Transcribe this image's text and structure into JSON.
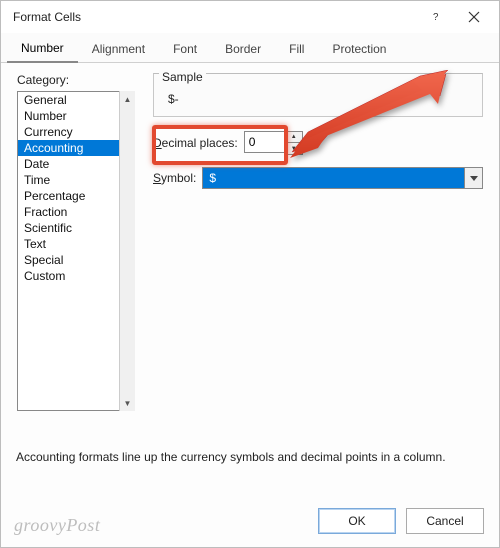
{
  "titlebar": {
    "title": "Format Cells"
  },
  "tabs": {
    "items": [
      "Number",
      "Alignment",
      "Font",
      "Border",
      "Fill",
      "Protection"
    ],
    "active_index": 0
  },
  "category": {
    "label": "Category:",
    "items": [
      "General",
      "Number",
      "Currency",
      "Accounting",
      "Date",
      "Time",
      "Percentage",
      "Fraction",
      "Scientific",
      "Text",
      "Special",
      "Custom"
    ],
    "selected_index": 3
  },
  "sample": {
    "label": "Sample",
    "value": "$-"
  },
  "decimal": {
    "label": "Decimal places:",
    "value": "0"
  },
  "symbol": {
    "label": "Symbol:",
    "value": "$"
  },
  "description": "Accounting formats line up the currency symbols and decimal points in a column.",
  "footer": {
    "ok": "OK",
    "cancel": "Cancel"
  },
  "watermark": "groovyPost"
}
